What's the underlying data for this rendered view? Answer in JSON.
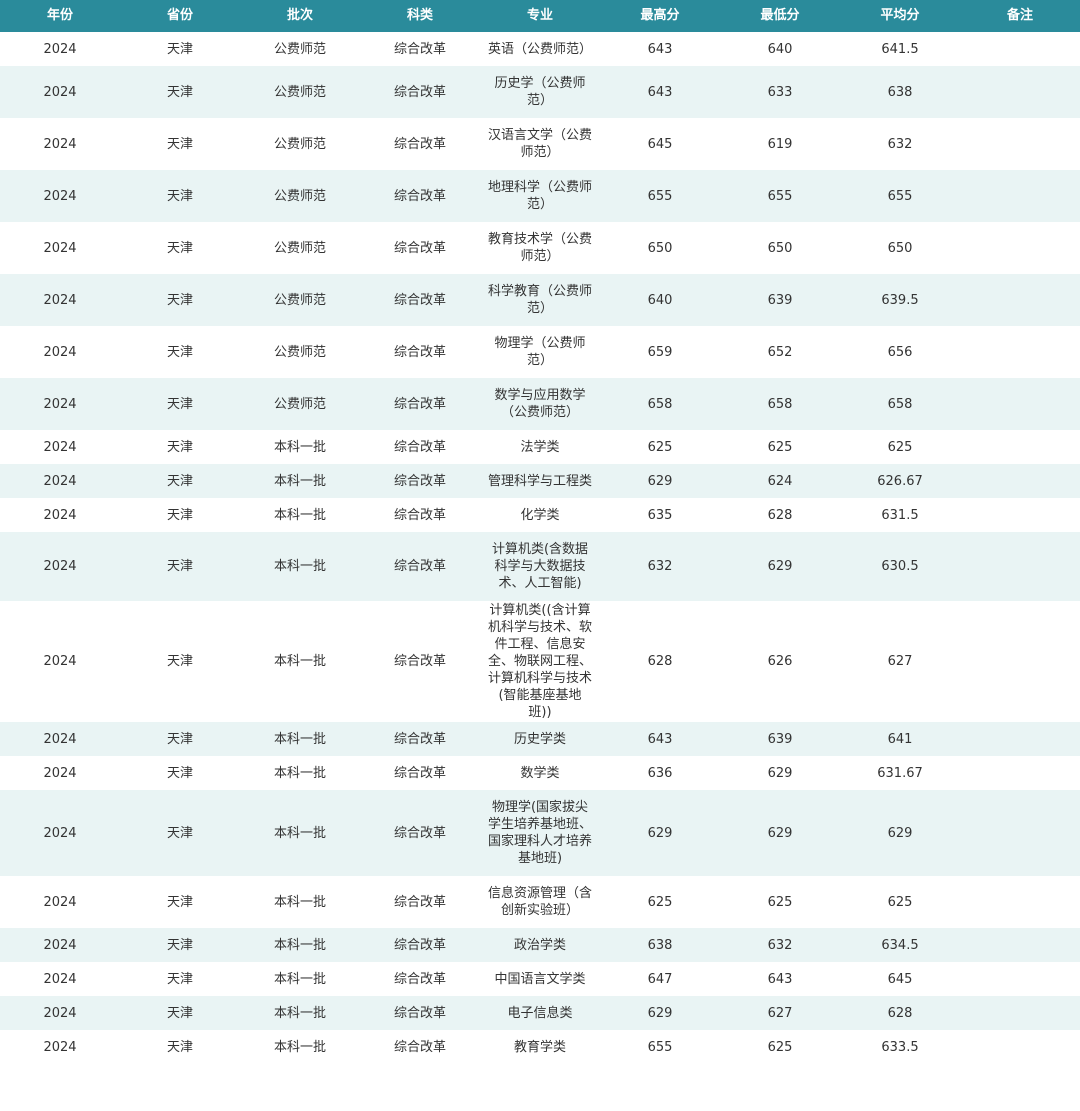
{
  "headers": [
    "年份",
    "省份",
    "批次",
    "科类",
    "专业",
    "最高分",
    "最低分",
    "平均分",
    "备注"
  ],
  "rows": [
    {
      "year": "2024",
      "province": "天津",
      "batch": "公费师范",
      "type": "综合改革",
      "major": "英语（公费师范）",
      "max": "643",
      "min": "640",
      "avg": "641.5",
      "note": ""
    },
    {
      "year": "2024",
      "province": "天津",
      "batch": "公费师范",
      "type": "综合改革",
      "major": "历史学（公费师范）",
      "max": "643",
      "min": "633",
      "avg": "638",
      "note": ""
    },
    {
      "year": "2024",
      "province": "天津",
      "batch": "公费师范",
      "type": "综合改革",
      "major": "汉语言文学（公费师范）",
      "max": "645",
      "min": "619",
      "avg": "632",
      "note": ""
    },
    {
      "year": "2024",
      "province": "天津",
      "batch": "公费师范",
      "type": "综合改革",
      "major": "地理科学（公费师范）",
      "max": "655",
      "min": "655",
      "avg": "655",
      "note": ""
    },
    {
      "year": "2024",
      "province": "天津",
      "batch": "公费师范",
      "type": "综合改革",
      "major": "教育技术学（公费师范）",
      "max": "650",
      "min": "650",
      "avg": "650",
      "note": ""
    },
    {
      "year": "2024",
      "province": "天津",
      "batch": "公费师范",
      "type": "综合改革",
      "major": "科学教育（公费师范）",
      "max": "640",
      "min": "639",
      "avg": "639.5",
      "note": ""
    },
    {
      "year": "2024",
      "province": "天津",
      "batch": "公费师范",
      "type": "综合改革",
      "major": "物理学（公费师范）",
      "max": "659",
      "min": "652",
      "avg": "656",
      "note": ""
    },
    {
      "year": "2024",
      "province": "天津",
      "batch": "公费师范",
      "type": "综合改革",
      "major": "数学与应用数学（公费师范）",
      "max": "658",
      "min": "658",
      "avg": "658",
      "note": ""
    },
    {
      "year": "2024",
      "province": "天津",
      "batch": "本科一批",
      "type": "综合改革",
      "major": "法学类",
      "max": "625",
      "min": "625",
      "avg": "625",
      "note": ""
    },
    {
      "year": "2024",
      "province": "天津",
      "batch": "本科一批",
      "type": "综合改革",
      "major": "管理科学与工程类",
      "max": "629",
      "min": "624",
      "avg": "626.67",
      "note": ""
    },
    {
      "year": "2024",
      "province": "天津",
      "batch": "本科一批",
      "type": "综合改革",
      "major": "化学类",
      "max": "635",
      "min": "628",
      "avg": "631.5",
      "note": ""
    },
    {
      "year": "2024",
      "province": "天津",
      "batch": "本科一批",
      "type": "综合改革",
      "major": "计算机类(含数据科学与大数据技术、人工智能)",
      "max": "632",
      "min": "629",
      "avg": "630.5",
      "note": ""
    },
    {
      "year": "2024",
      "province": "天津",
      "batch": "本科一批",
      "type": "综合改革",
      "major": "计算机类((含计算机科学与技术、软件工程、信息安全、物联网工程、计算机科学与技术(智能基座基地班))",
      "max": "628",
      "min": "626",
      "avg": "627",
      "note": ""
    },
    {
      "year": "2024",
      "province": "天津",
      "batch": "本科一批",
      "type": "综合改革",
      "major": "历史学类",
      "max": "643",
      "min": "639",
      "avg": "641",
      "note": ""
    },
    {
      "year": "2024",
      "province": "天津",
      "batch": "本科一批",
      "type": "综合改革",
      "major": "数学类",
      "max": "636",
      "min": "629",
      "avg": "631.67",
      "note": ""
    },
    {
      "year": "2024",
      "province": "天津",
      "batch": "本科一批",
      "type": "综合改革",
      "major": "物理学(国家拔尖学生培养基地班、国家理科人才培养基地班)",
      "max": "629",
      "min": "629",
      "avg": "629",
      "note": ""
    },
    {
      "year": "2024",
      "province": "天津",
      "batch": "本科一批",
      "type": "综合改革",
      "major": "信息资源管理（含创新实验班）",
      "max": "625",
      "min": "625",
      "avg": "625",
      "note": ""
    },
    {
      "year": "2024",
      "province": "天津",
      "batch": "本科一批",
      "type": "综合改革",
      "major": "政治学类",
      "max": "638",
      "min": "632",
      "avg": "634.5",
      "note": ""
    },
    {
      "year": "2024",
      "province": "天津",
      "batch": "本科一批",
      "type": "综合改革",
      "major": "中国语言文学类",
      "max": "647",
      "min": "643",
      "avg": "645",
      "note": ""
    },
    {
      "year": "2024",
      "province": "天津",
      "batch": "本科一批",
      "type": "综合改革",
      "major": "电子信息类",
      "max": "629",
      "min": "627",
      "avg": "628",
      "note": ""
    },
    {
      "year": "2024",
      "province": "天津",
      "batch": "本科一批",
      "type": "综合改革",
      "major": "教育学类",
      "max": "655",
      "min": "625",
      "avg": "633.5",
      "note": ""
    }
  ]
}
